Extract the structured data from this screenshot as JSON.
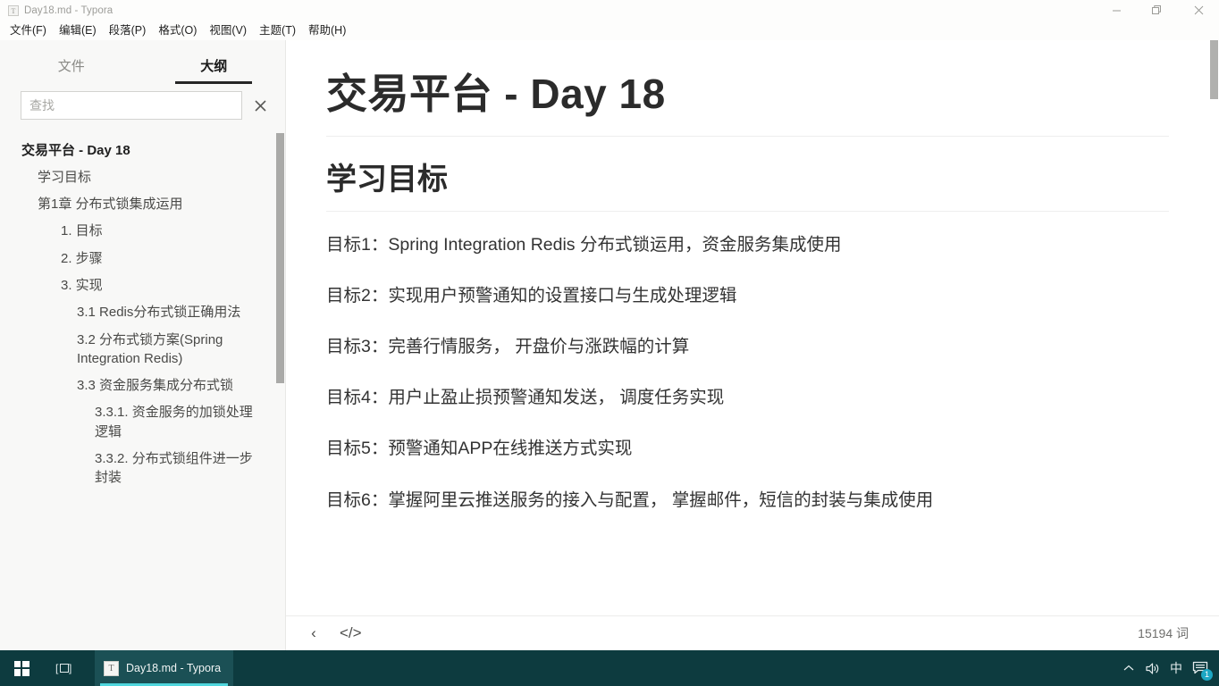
{
  "window": {
    "title": "Day18.md - Typora",
    "app_icon": "T",
    "controls": {
      "minimize": "minimize-icon",
      "restore": "restore-icon",
      "close": "close-icon"
    }
  },
  "menubar": {
    "items": [
      {
        "label": "文件(F)",
        "name": "menu-file"
      },
      {
        "label": "编辑(E)",
        "name": "menu-edit"
      },
      {
        "label": "段落(P)",
        "name": "menu-paragraph"
      },
      {
        "label": "格式(O)",
        "name": "menu-format"
      },
      {
        "label": "视图(V)",
        "name": "menu-view"
      },
      {
        "label": "主题(T)",
        "name": "menu-theme"
      },
      {
        "label": "帮助(H)",
        "name": "menu-help"
      }
    ]
  },
  "sidebar": {
    "tabs": [
      {
        "label": "文件",
        "active": false
      },
      {
        "label": "大纲",
        "active": true
      }
    ],
    "search": {
      "placeholder": "查找",
      "value": "",
      "clear_icon": "×"
    },
    "outline": [
      {
        "label": "交易平台 - Day 18",
        "level": 1
      },
      {
        "label": "学习目标",
        "level": 2
      },
      {
        "label": "第1章 分布式锁集成运用",
        "level": 2
      },
      {
        "label": "1. 目标",
        "level": 3
      },
      {
        "label": "2. 步骤",
        "level": 3
      },
      {
        "label": "3. 实现",
        "level": 3
      },
      {
        "label": "3.1 Redis分布式锁正确用法",
        "level": 4
      },
      {
        "label": "3.2 分布式锁方案(Spring Integration Redis)",
        "level": 4
      },
      {
        "label": "3.3 资金服务集成分布式锁",
        "level": 4
      },
      {
        "label": "3.3.1. 资金服务的加锁处理逻辑",
        "level": 5
      },
      {
        "label": "3.3.2. 分布式锁组件进一步封装",
        "level": 5
      }
    ]
  },
  "document": {
    "h1": "交易平台 - Day 18",
    "h2": "学习目标",
    "paragraphs": [
      "目标1：Spring Integration Redis 分布式锁运用，资金服务集成使用",
      "目标2：实现用户预警通知的设置接口与生成处理逻辑",
      "目标3：完善行情服务， 开盘价与涨跌幅的计算",
      "目标4：用户止盈止损预警通知发送， 调度任务实现",
      "目标5：预警通知APP在线推送方式实现",
      "目标6：掌握阿里云推送服务的接入与配置， 掌握邮件，短信的封装与集成使用"
    ]
  },
  "statusbar": {
    "sidebar_toggle_icon": "‹",
    "source_mode_icon": "</>",
    "word_count": "15194 词"
  },
  "taskbar": {
    "start_icon": "windows-logo",
    "taskview_icon": "[ ]",
    "task": {
      "icon": "T",
      "label": "Day18.md - Typora"
    },
    "tray": [
      {
        "name": "show-hidden-icons",
        "glyph": "⌃"
      },
      {
        "name": "volume-icon",
        "glyph": "🔊"
      },
      {
        "name": "ime-indicator",
        "glyph": "中"
      },
      {
        "name": "notifications-icon",
        "glyph": "▤",
        "badge": "1"
      }
    ]
  },
  "colors": {
    "titlebar_bg": "#fdfdfc",
    "sidebar_bg": "#f8f8f7",
    "editor_bg": "#ffffff",
    "taskbar_bg": "#0d3b3f",
    "accent": "#4fd6dd",
    "text": "#333333"
  }
}
